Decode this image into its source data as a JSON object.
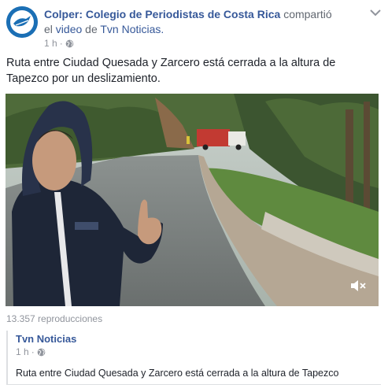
{
  "post": {
    "page_name": "Colper: Colegio de Periodistas de Costa Rica",
    "action_text": "compartió el",
    "video_link": "video",
    "preposition": "de",
    "source_page": "Tvn Noticias.",
    "timestamp": "1 h",
    "separator": "·",
    "message": "Ruta entre Ciudad Quesada y Zarcero está cerrada a la altura de Tapezco por un deslizamiento.",
    "views": "13.357 reproducciones"
  },
  "shared": {
    "page_name": "Tvn Noticias",
    "timestamp": "1 h",
    "separator": "·",
    "text": "Ruta entre Ciudad Quesada y Zarcero está cerrada a la altura de Tapezco"
  },
  "icons": {
    "avatar": "colper-logo",
    "privacy": "globe-icon",
    "options": "chevron-down-icon",
    "volume": "muted-speaker-icon"
  },
  "colors": {
    "link": "#365899",
    "meta": "#90949c",
    "text": "#1d2129"
  }
}
